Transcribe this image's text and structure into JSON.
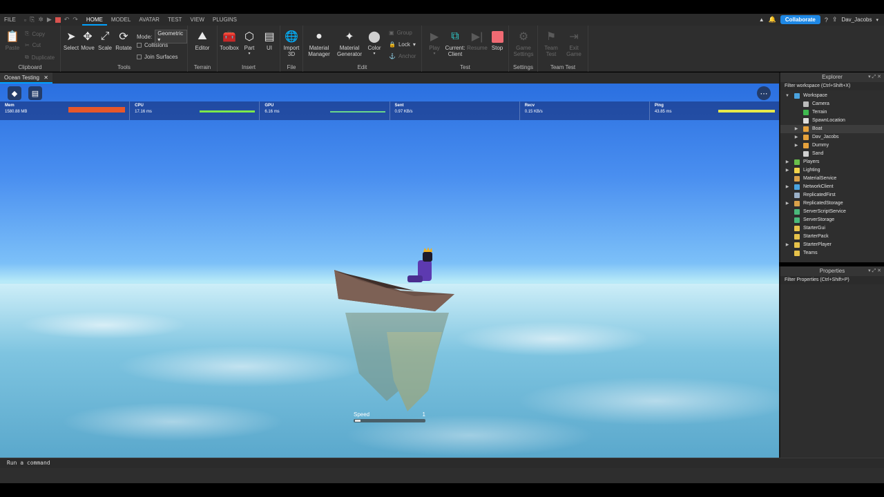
{
  "menubar": {
    "file": "FILE",
    "tabs": [
      "HOME",
      "MODEL",
      "AVATAR",
      "TEST",
      "VIEW",
      "PLUGINS"
    ],
    "collaborate": "Collaborate",
    "user": "Dav_Jacobs"
  },
  "ribbon": {
    "clipboard": {
      "label": "Clipboard",
      "paste": "Paste",
      "copy": "Copy",
      "cut": "Cut",
      "duplicate": "Duplicate"
    },
    "tools": {
      "label": "Tools",
      "select": "Select",
      "move": "Move",
      "scale": "Scale",
      "rotate": "Rotate",
      "mode_label": "Mode:",
      "mode_value": "Geometric",
      "collisions": "Collisions",
      "join_surfaces": "Join Surfaces"
    },
    "terrain": {
      "label": "Terrain",
      "editor": "Editor"
    },
    "insert": {
      "label": "Insert",
      "toolbox": "Toolbox",
      "part": "Part",
      "ui": "UI"
    },
    "file": {
      "label": "File",
      "import3d": "Import 3D"
    },
    "edit": {
      "label": "Edit",
      "material_manager": "Material Manager",
      "material_generator": "Material Generator",
      "color": "Color",
      "group": "Group",
      "lock": "Lock",
      "anchor": "Anchor"
    },
    "test": {
      "label": "Test",
      "play": "Play",
      "current_client": "Current: Client",
      "resume": "Resume",
      "stop": "Stop"
    },
    "settings": {
      "label": "Settings",
      "game_settings": "Game Settings"
    },
    "team_test": {
      "label": "Team Test",
      "team_test_btn": "Team Test",
      "exit_game": "Exit Game"
    }
  },
  "document_tab": "Ocean Testing",
  "stats": [
    {
      "name": "Mem",
      "value": "1580.88 MB",
      "bar_color": "#e8572a",
      "bar_fill": 1.0
    },
    {
      "name": "CPU",
      "value": "17.16 ms",
      "bar_color": "#7be84a",
      "bar_fill": 1.0
    },
    {
      "name": "GPU",
      "value": "6.16 ms",
      "bar_color": "#6ad88a",
      "bar_fill": 1.0
    },
    {
      "name": "Sent",
      "value": "0.97 KB/s",
      "bar_color": "#7be84a",
      "bar_fill": 0
    },
    {
      "name": "Recv",
      "value": "0.15 KB/s",
      "bar_color": "#7be84a",
      "bar_fill": 0
    },
    {
      "name": "Ping",
      "value": "43.85 ms",
      "bar_color": "#e8e84a",
      "bar_fill": 1.0
    }
  ],
  "speed": {
    "label": "Speed",
    "value": "1",
    "fill": 0.08
  },
  "command_placeholder": "Run a command",
  "explorer": {
    "title": "Explorer",
    "filter": "Filter workspace (Ctrl+Shift+X)",
    "items": [
      {
        "label": "Workspace",
        "depth": 0,
        "expanded": true,
        "icon_color": "#4aa3df"
      },
      {
        "label": "Camera",
        "depth": 1,
        "icon_color": "#bbbbbb"
      },
      {
        "label": "Terrain",
        "depth": 1,
        "icon_color": "#3fb950"
      },
      {
        "label": "SpawnLocation",
        "depth": 1,
        "icon_color": "#dddddd"
      },
      {
        "label": "Boat",
        "depth": 1,
        "collapsed": true,
        "icon_color": "#e6a23c",
        "selected": true
      },
      {
        "label": "Dav_Jacobs",
        "depth": 1,
        "collapsed": true,
        "icon_color": "#e6a23c"
      },
      {
        "label": "Dummy",
        "depth": 1,
        "collapsed": true,
        "icon_color": "#e6a23c"
      },
      {
        "label": "Sand",
        "depth": 1,
        "icon_color": "#d0d0d0"
      },
      {
        "label": "Players",
        "depth": 0,
        "collapsed": true,
        "icon_color": "#6abf4b"
      },
      {
        "label": "Lighting",
        "depth": 0,
        "collapsed": true,
        "icon_color": "#f2d34b"
      },
      {
        "label": "MaterialService",
        "depth": 0,
        "icon_color": "#d9a14a"
      },
      {
        "label": "NetworkClient",
        "depth": 0,
        "collapsed": true,
        "icon_color": "#4aa3df"
      },
      {
        "label": "ReplicatedFirst",
        "depth": 0,
        "icon_color": "#9ab0c8"
      },
      {
        "label": "ReplicatedStorage",
        "depth": 0,
        "collapsed": true,
        "icon_color": "#d9a14a"
      },
      {
        "label": "ServerScriptService",
        "depth": 0,
        "icon_color": "#4ab87a"
      },
      {
        "label": "ServerStorage",
        "depth": 0,
        "icon_color": "#4ab87a"
      },
      {
        "label": "StarterGui",
        "depth": 0,
        "icon_color": "#e6c24a"
      },
      {
        "label": "StarterPack",
        "depth": 0,
        "icon_color": "#e6c24a"
      },
      {
        "label": "StarterPlayer",
        "depth": 0,
        "collapsed": true,
        "icon_color": "#e6c24a"
      },
      {
        "label": "Teams",
        "depth": 0,
        "icon_color": "#e6c24a"
      }
    ]
  },
  "properties": {
    "title": "Properties",
    "filter": "Filter Properties (Ctrl+Shift+P)"
  }
}
